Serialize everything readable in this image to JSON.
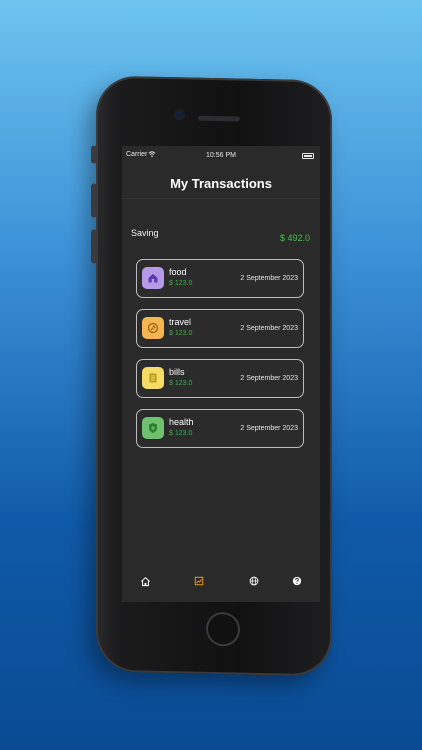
{
  "status_bar": {
    "carrier": "Carrier",
    "time": "10:56 PM"
  },
  "header": {
    "title": "My Transactions"
  },
  "summary": {
    "label": "Saving",
    "value": "$ 492.0"
  },
  "transactions": [
    {
      "name": "food",
      "amount": "$ 123.0",
      "date": "2 September 2023",
      "icon": "home-icon",
      "color": "#b69ae8"
    },
    {
      "name": "travel",
      "amount": "$ 123.0",
      "date": "2 September 2023",
      "icon": "travel-icon",
      "color": "#f5b652"
    },
    {
      "name": "bills",
      "amount": "$ 123.0",
      "date": "2 September 2023",
      "icon": "bills-icon",
      "color": "#f4dc66"
    },
    {
      "name": "health",
      "amount": "$ 123.0",
      "date": "2 September 2023",
      "icon": "shield-icon",
      "color": "#6fc06f"
    }
  ],
  "tabbar": {
    "tabs": [
      {
        "icon": "home-icon",
        "active": false
      },
      {
        "icon": "chart-icon",
        "active": true
      },
      {
        "icon": "globe-icon",
        "active": false
      },
      {
        "icon": "help-icon",
        "active": false
      }
    ],
    "active_color": "#f4a41a",
    "inactive_color": "#ffffff"
  },
  "colors": {
    "accent_green": "#4bbf4b",
    "background": "#2a2a2a"
  }
}
